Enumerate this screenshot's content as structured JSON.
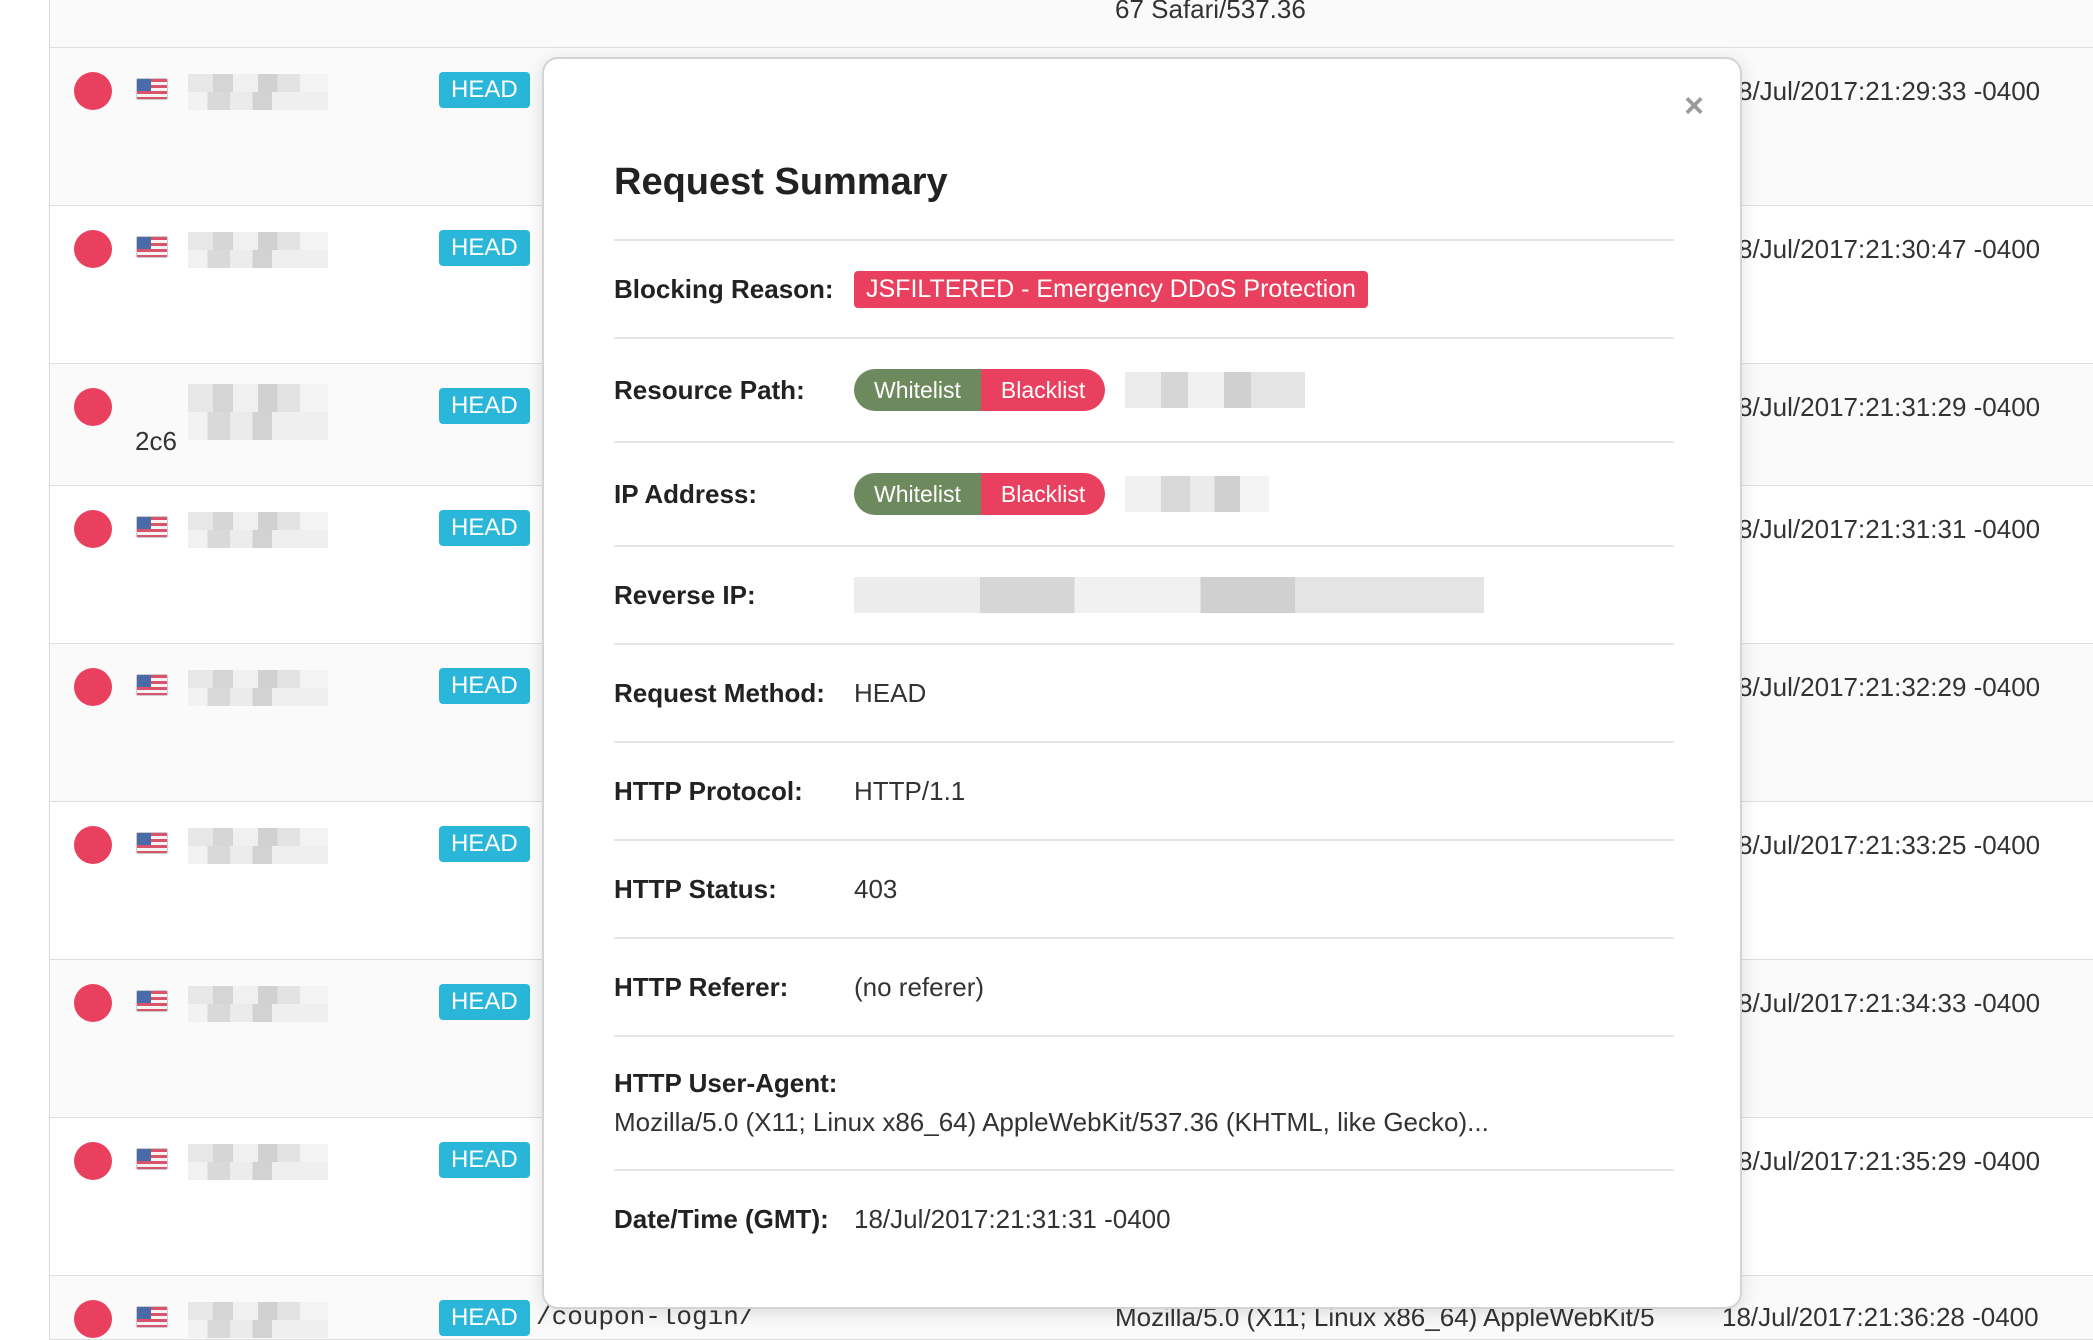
{
  "table": {
    "top_partial_text": "67 Safari/537.36",
    "rows": [
      {
        "method": "HEAD",
        "timestamp": "8/Jul/2017:21:29:33 -0400"
      },
      {
        "method": "HEAD",
        "timestamp": "8/Jul/2017:21:30:47 -0400"
      },
      {
        "method": "HEAD",
        "timestamp": "8/Jul/2017:21:31:29 -0400",
        "extra": "2c6"
      },
      {
        "method": "HEAD",
        "timestamp": "8/Jul/2017:21:31:31 -0400"
      },
      {
        "method": "HEAD",
        "timestamp": "8/Jul/2017:21:32:29 -0400"
      },
      {
        "method": "HEAD",
        "timestamp": "8/Jul/2017:21:33:25 -0400"
      },
      {
        "method": "HEAD",
        "timestamp": "8/Jul/2017:21:34:33 -0400"
      },
      {
        "method": "HEAD",
        "timestamp": "8/Jul/2017:21:35:29 -0400"
      },
      {
        "method": "HEAD",
        "timestamp": "18/Jul/2017:21:36:28 -0400",
        "path": "/coupon-login/",
        "user_agent": "Mozilla/5.0 (X11; Linux x86_64) AppleWebKit/5"
      }
    ],
    "slash": "/"
  },
  "modal": {
    "close_icon": "×",
    "title": "Request Summary",
    "blocking_reason": {
      "label": "Blocking Reason:",
      "value": "JSFILTERED - Emergency DDoS Protection"
    },
    "resource_path": {
      "label": "Resource Path:",
      "whitelist": "Whitelist",
      "blacklist": "Blacklist"
    },
    "ip_address": {
      "label": "IP Address:",
      "whitelist": "Whitelist",
      "blacklist": "Blacklist"
    },
    "reverse_ip": {
      "label": "Reverse IP:"
    },
    "request_method": {
      "label": "Request Method:",
      "value": "HEAD"
    },
    "http_protocol": {
      "label": "HTTP Protocol:",
      "value": "HTTP/1.1"
    },
    "http_status": {
      "label": "HTTP Status:",
      "value": "403"
    },
    "http_referer": {
      "label": "HTTP Referer:",
      "value": "(no referer)"
    },
    "http_user_agent": {
      "label": "HTTP User-Agent:",
      "value": "Mozilla/5.0 (X11; Linux x86_64) AppleWebKit/537.36 (KHTML, like Gecko)..."
    },
    "date_time": {
      "label": "Date/Time (GMT):",
      "value": "18/Jul/2017:21:31:31 -0400"
    }
  },
  "colors": {
    "danger": "#e8405e",
    "success": "#6d8a5e",
    "method": "#29b6d8"
  }
}
